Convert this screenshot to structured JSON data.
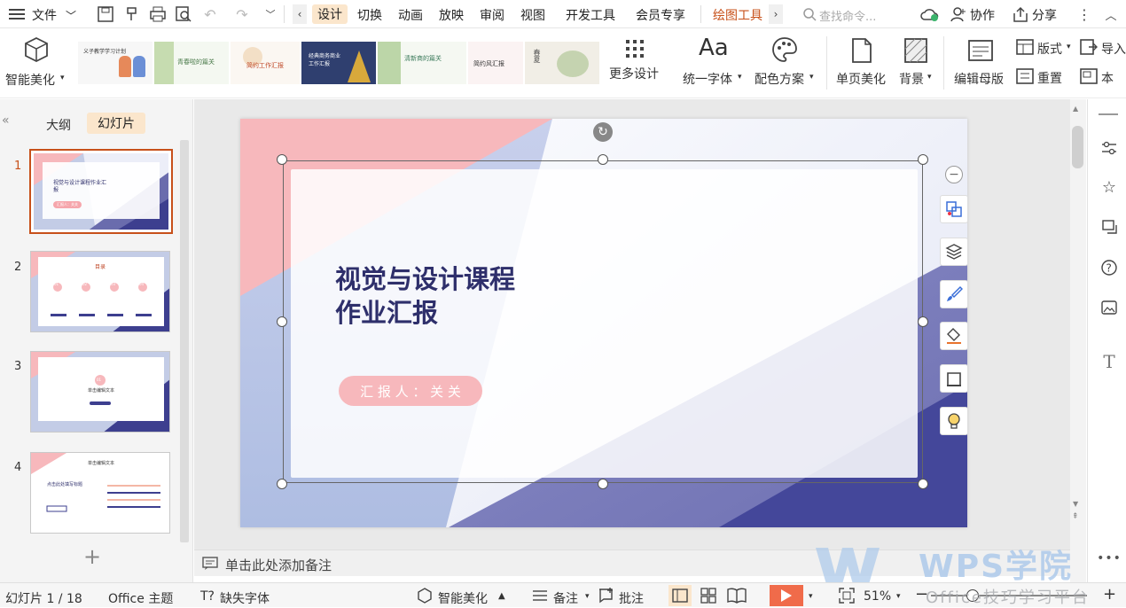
{
  "menu": {
    "file": "文件",
    "tabs": [
      "设计",
      "切换",
      "动画",
      "放映",
      "审阅",
      "视图",
      "开发工具",
      "会员专享"
    ],
    "active_tab": "设计",
    "drawing_tools": "绘图工具",
    "search_placeholder": "查找命令...",
    "collab": "协作",
    "share": "分享"
  },
  "ribbon": {
    "smart_beautify": "智能美化",
    "more_design": "更多设计",
    "unify_font": "统一字体",
    "color_scheme": "配色方案",
    "page_beautify": "单页美化",
    "background": "背景",
    "edit_master": "编辑母版",
    "layout": "版式",
    "reset": "重置",
    "import": "导入",
    "this": "本",
    "aa": "Aa",
    "template_texts": [
      "义子教学学习计划",
      "青春啦的篇关",
      "简约工作汇报",
      "经典商务商业工作汇报",
      "清新商的篇关",
      "简约风汇报",
      "春夏"
    ]
  },
  "leftpanel": {
    "tab_outline": "大纲",
    "tab_slides": "幻灯片",
    "slide_numbers": [
      "1",
      "2",
      "3",
      "4"
    ],
    "thumb1_title": "视觉与设计课程作业汇报",
    "thumb1_sub": "汇报人：关关",
    "thumb2_title": "目录",
    "thumb2_items": [
      "01",
      "02",
      "03",
      "04"
    ],
    "thumb3_circle": "01",
    "thumb3_title": "单击编辑文本",
    "thumb4_title": "单击编辑文本",
    "thumb4_heading": "点击此处填写标题",
    "add": "+"
  },
  "slide": {
    "title_line1": "视觉与设计课程",
    "title_line2": "作业汇报",
    "presenter": "汇 报 人 ： 关 关"
  },
  "notes": {
    "placeholder": "单击此处添加备注"
  },
  "status": {
    "slide_counter": "幻灯片 1 / 18",
    "theme": "Office 主题",
    "missing_font": "缺失字体",
    "smart_beautify": "智能美化",
    "notes": "备注",
    "comments": "批注",
    "zoom": "51%"
  },
  "watermark": {
    "brand": "WPS学院",
    "tagline": "Office技巧学习平台"
  },
  "colors": {
    "accent": "#c7501a",
    "tab_active_bg": "#fbe6cc",
    "pink": "#f7b8bc",
    "navy": "#3d3f8f",
    "play": "#f06b4a"
  }
}
